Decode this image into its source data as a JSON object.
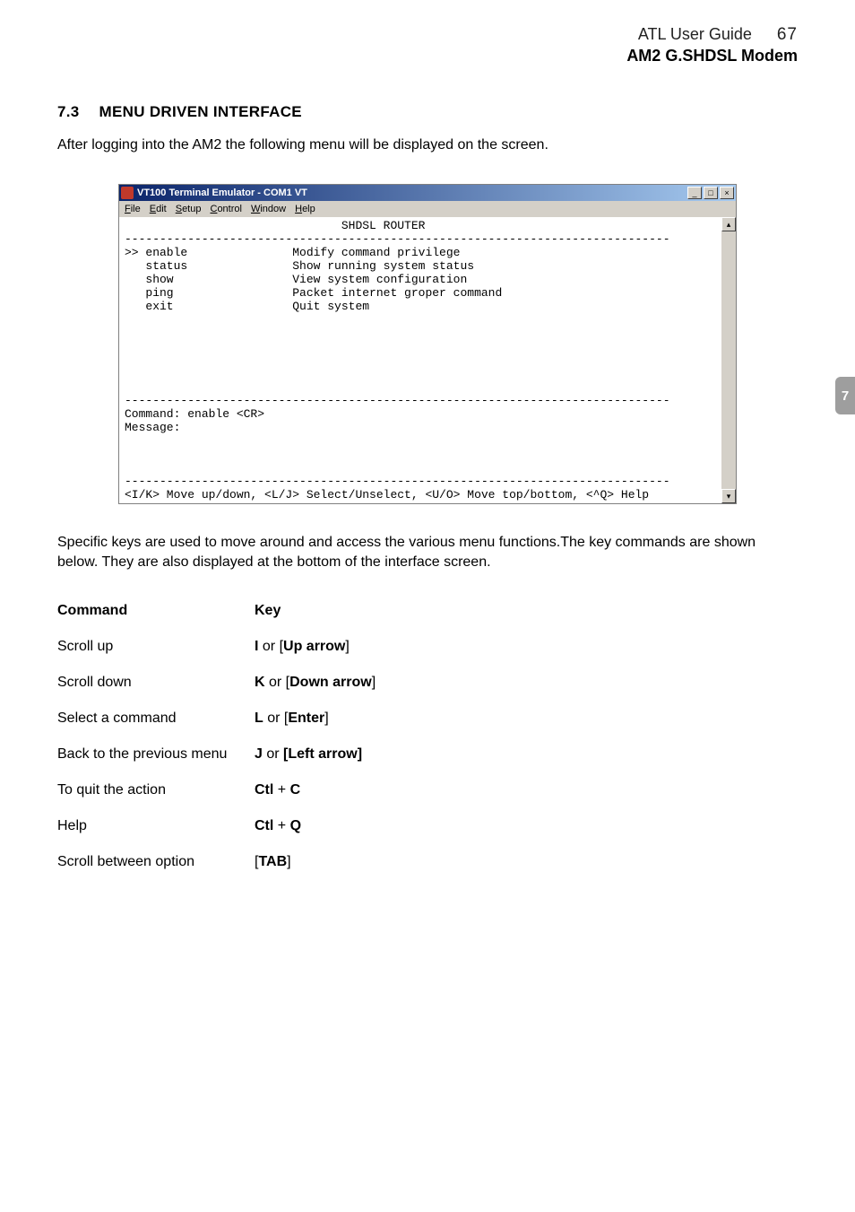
{
  "header": {
    "guide_title": "ATL User Guide",
    "page_number": "67",
    "product": "AM2 G.SHDSL Modem"
  },
  "section": {
    "number": "7.3",
    "title": "MENU DRIVEN INTERFACE"
  },
  "intro_text": "After logging into the AM2 the following menu will be displayed on the screen.",
  "terminal": {
    "window_title": "VT100 Terminal Emulator - COM1 VT",
    "menus": [
      "File",
      "Edit",
      "Setup",
      "Control",
      "Window",
      "Help"
    ],
    "screen_title_line": "                               SHDSL ROUTER",
    "dash_line": "------------------------------------------------------------------------------",
    "menu_items": [
      {
        "left": ">> enable",
        "right": "Modify command privilege"
      },
      {
        "left": "   status",
        "right": "Show running system status"
      },
      {
        "left": "   show",
        "right": "View system configuration"
      },
      {
        "left": "   ping",
        "right": "Packet internet groper command"
      },
      {
        "left": "   exit",
        "right": "Quit system"
      }
    ],
    "command_line": "Command: enable <CR>",
    "message_line": "Message:",
    "help_line": "<I/K> Move up/down, <L/J> Select/Unselect, <U/O> Move top/bottom, <^Q> Help"
  },
  "after_screen_text": "Specific keys are used to move around and access the various menu functions.The key commands are shown below. They are also displayed at the bottom of the interface screen.",
  "command_table": {
    "headers": {
      "c1": "Command",
      "c2": "Key"
    },
    "rows": [
      {
        "command": "Scroll up",
        "key_parts": [
          "**I**",
          " or [",
          "**Up arrow**",
          "]"
        ]
      },
      {
        "command": "Scroll down",
        "key_parts": [
          "**K**",
          " or [",
          "**Down arrow**",
          "]"
        ]
      },
      {
        "command": "Select a command",
        "key_parts": [
          "**L**",
          " or [",
          "**Enter**",
          "]"
        ]
      },
      {
        "command": "Back to the previous menu",
        "key_parts": [
          "**J**",
          " or ",
          "**[Left arrow]**"
        ]
      },
      {
        "command": "To quit the action",
        "key_parts": [
          "**Ctl**",
          " + ",
          "**C**"
        ]
      },
      {
        "command": "Help",
        "key_parts": [
          "**Ctl**",
          " + ",
          "**Q**"
        ]
      },
      {
        "command": "Scroll between option",
        "key_parts": [
          "[",
          "**TAB**",
          "]"
        ]
      }
    ]
  },
  "side_tab_label": "7"
}
